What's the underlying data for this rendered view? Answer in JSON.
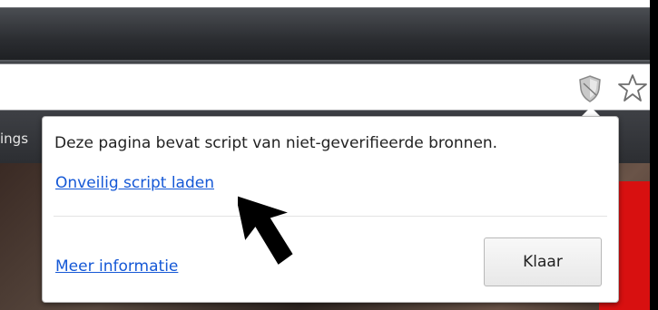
{
  "bookmarks": {
    "partial_label": "ings"
  },
  "omnibox": {
    "shield_icon": "blocked-script-shield-icon",
    "star_icon": "bookmark-star-icon"
  },
  "popup": {
    "message": "Deze pagina bevat script van niet-geverifieerde bronnen.",
    "load_link": "Onveilig script laden",
    "more_info_link": "Meer informatie",
    "done_button": "Klaar"
  },
  "colors": {
    "link": "#1558d6",
    "red_banner": "#d81010"
  }
}
